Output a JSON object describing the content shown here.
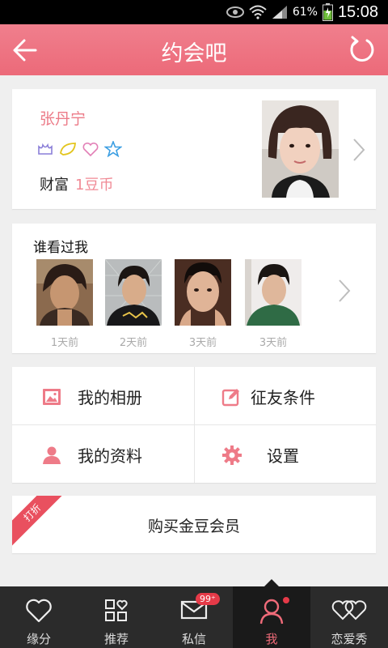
{
  "status_bar": {
    "battery": "61%",
    "time": "15:08"
  },
  "header": {
    "title": "约会吧"
  },
  "profile": {
    "name": "张丹宁",
    "wealth_label": "财富",
    "wealth_value": "1豆币"
  },
  "visitors": {
    "title": "谁看过我",
    "items": [
      {
        "time": "1天前"
      },
      {
        "time": "2天前"
      },
      {
        "time": "3天前"
      },
      {
        "time": "3天前"
      }
    ]
  },
  "menu": {
    "album": "我的相册",
    "criteria": "征友条件",
    "info": "我的资料",
    "settings": "设置"
  },
  "vip": {
    "label": "购买金豆会员",
    "ribbon": "打折"
  },
  "tabs": [
    {
      "label": "缘分"
    },
    {
      "label": "推荐"
    },
    {
      "label": "私信",
      "badge": "99⁺"
    },
    {
      "label": "我"
    },
    {
      "label": "恋爱秀"
    }
  ],
  "colors": {
    "accent": "#ec6a79",
    "tab_bg": "#2b2b2b",
    "badge": "#e53a48"
  }
}
